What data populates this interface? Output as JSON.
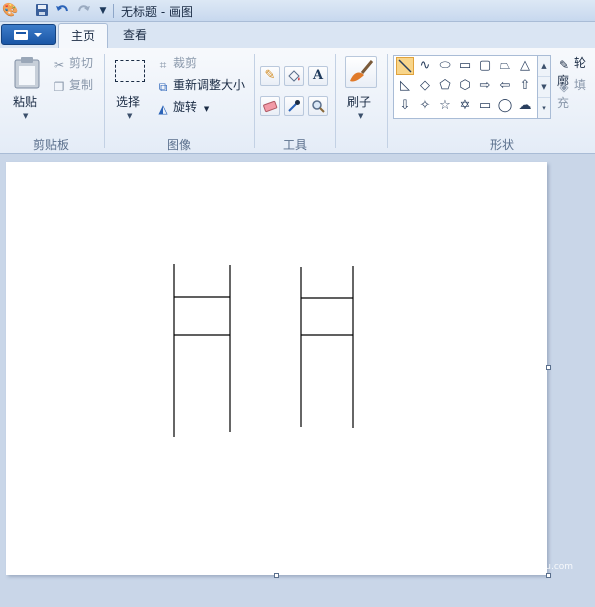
{
  "titlebar": {
    "title": "无标题 - 画图"
  },
  "tabs": {
    "home": "主页",
    "view": "查看"
  },
  "clipboard": {
    "paste": "粘贴",
    "cut": "剪切",
    "copy": "复制",
    "group_label": "剪贴板"
  },
  "image": {
    "select": "选择",
    "crop": "裁剪",
    "resize": "重新调整大小",
    "rotate": "旋转",
    "group_label": "图像"
  },
  "tools": {
    "group_label": "工具",
    "items": [
      "pencil-icon",
      "fill-icon",
      "text-icon",
      "eraser-icon",
      "color-picker-icon",
      "magnifier-icon"
    ]
  },
  "brushes": {
    "label": "刷子"
  },
  "shapes": {
    "group_label": "形状",
    "outline": "轮廓",
    "fill": "填充"
  },
  "watermark": {
    "text": "Baidu经验",
    "sub": "jingyan.baidu.com"
  },
  "colors": {
    "accent": "#1a56a6",
    "ribbon_bg": "#e4ecf7",
    "workspace_bg": "#c9d6e8",
    "selected_shape": "#f8d58a"
  }
}
